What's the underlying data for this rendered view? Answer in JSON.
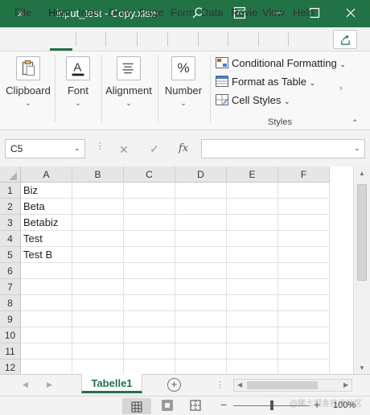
{
  "titlebar": {
    "qat_glyph": "»",
    "title": "input_test - Copy.xlsx",
    "title_dropdown": "⌄",
    "colors": {
      "bg": "#217346",
      "fg": "#ffffff"
    },
    "icons": [
      "search-icon",
      "ribbon-display-options-icon",
      "minimize-icon",
      "maximize-icon",
      "close-icon"
    ]
  },
  "ribbon_tabs": [
    {
      "label": "File"
    },
    {
      "label": "Hom",
      "active": true
    },
    {
      "label": "Inser"
    },
    {
      "label": "Draw"
    },
    {
      "label": "Page"
    },
    {
      "label": "Form"
    },
    {
      "label": "Data"
    },
    {
      "label": "Revie"
    },
    {
      "label": "View"
    },
    {
      "label": "Help"
    }
  ],
  "ribbon": {
    "groups": [
      {
        "label": "Clipboard",
        "icon": "clipboard-icon"
      },
      {
        "label": "Font",
        "icon": "font-color-icon"
      },
      {
        "label": "Alignment",
        "icon": "alignment-icon"
      },
      {
        "label": "Number",
        "icon": "percent-icon",
        "glyph": "%"
      }
    ],
    "chevron": "⌄",
    "styles": {
      "items": [
        {
          "label": "Conditional Formatting",
          "chevron": "⌄",
          "icon": "conditional-formatting-icon"
        },
        {
          "label": "Format as Table",
          "chevron": "⌄",
          "icon": "format-table-icon"
        },
        {
          "label": "Cell Styles",
          "chevron": "⌄",
          "icon": "cell-styles-icon"
        }
      ],
      "group_label": "Styles"
    },
    "scroll_right": "›",
    "collapse": "⌃"
  },
  "formula_bar": {
    "name_box": "C5",
    "dropdown": "⌄",
    "dots": "⋮",
    "cancel": "✕",
    "confirm": "✓",
    "fx": "fx",
    "value": ""
  },
  "grid": {
    "columns": [
      "A",
      "B",
      "C",
      "D",
      "E",
      "F"
    ],
    "rows": [
      "1",
      "2",
      "3",
      "4",
      "5",
      "6",
      "7",
      "8",
      "9",
      "10",
      "11",
      "12"
    ],
    "cells": [
      [
        "Biz",
        "",
        "",
        "",
        "",
        ""
      ],
      [
        "Beta",
        "",
        "",
        "",
        "",
        ""
      ],
      [
        "Betabiz",
        "",
        "",
        "",
        "",
        ""
      ],
      [
        "Test",
        "",
        "",
        "",
        "",
        ""
      ],
      [
        "Test B",
        "",
        "",
        "",
        "",
        ""
      ],
      [
        "",
        "",
        "",
        "",
        "",
        ""
      ],
      [
        "",
        "",
        "",
        "",
        "",
        ""
      ],
      [
        "",
        "",
        "",
        "",
        "",
        ""
      ],
      [
        "",
        "",
        "",
        "",
        "",
        ""
      ],
      [
        "",
        "",
        "",
        "",
        "",
        ""
      ],
      [
        "",
        "",
        "",
        "",
        "",
        ""
      ],
      [
        "",
        "",
        "",
        "",
        "",
        ""
      ]
    ]
  },
  "sheets": {
    "nav_prev": "◀",
    "nav_next": "▶",
    "tabs": [
      {
        "label": "Tabelle1",
        "active": true
      }
    ],
    "add": "+",
    "dots": "⋮"
  },
  "statusbar": {
    "zoom_minus": "−",
    "zoom_plus": "+",
    "zoom": "100%",
    "watermark": "@稀土掘金技术社区",
    "views": [
      "normal-view-icon",
      "page-layout-icon",
      "page-break-icon"
    ]
  }
}
